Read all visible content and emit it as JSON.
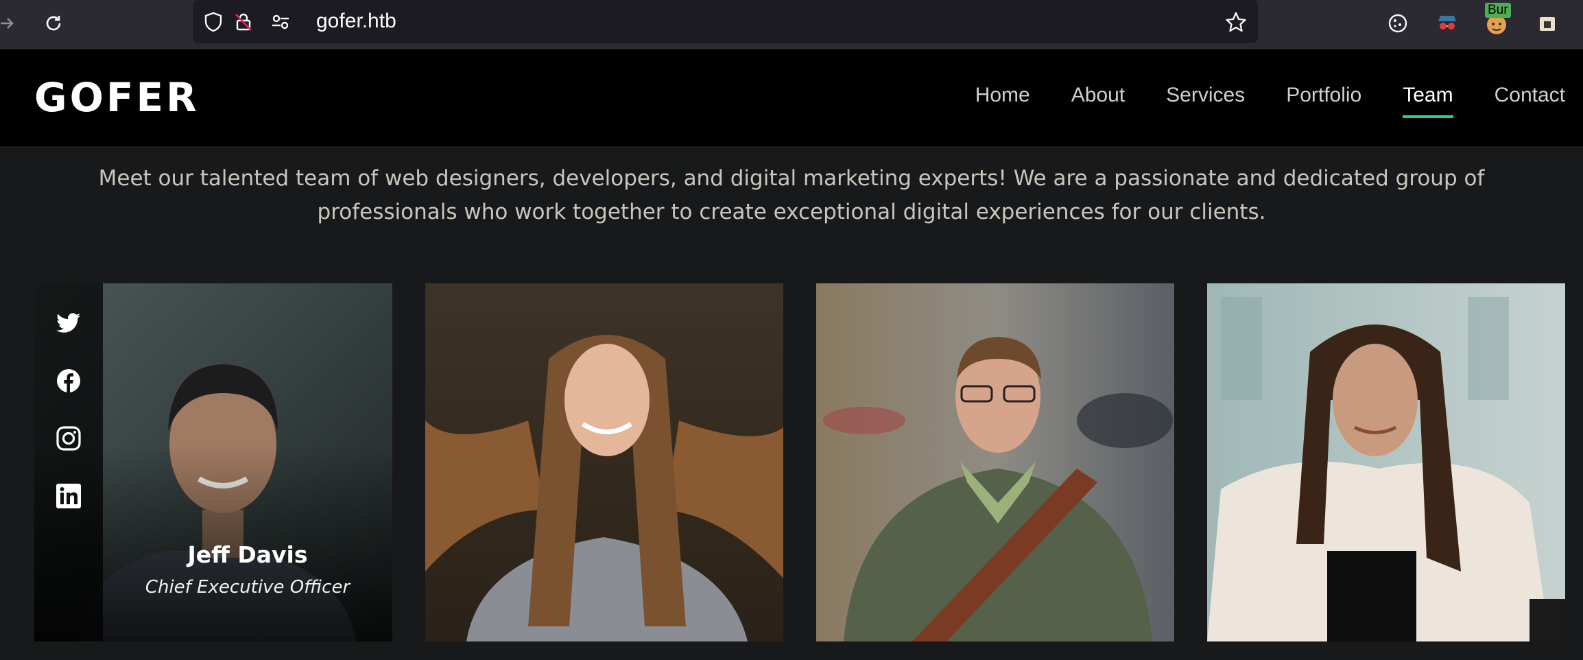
{
  "browser": {
    "url": "gofer.htb",
    "badge": "Bur"
  },
  "site": {
    "logo": "GOFER",
    "nav": [
      "Home",
      "About",
      "Services",
      "Portfolio",
      "Team",
      "Contact"
    ],
    "active_nav": "Team",
    "accent": "#18d2a6"
  },
  "team": {
    "intro": "Meet our talented team of web designers, developers, and digital marketing experts! We are a passionate and dedicated group of professionals who work together to create exceptional digital experiences for our clients.",
    "members": [
      {
        "name": "Jeff Davis",
        "role": "Chief Executive Officer",
        "social": [
          "twitter-icon",
          "facebook-icon",
          "instagram-icon",
          "linkedin-icon"
        ]
      },
      {
        "name": "",
        "role": ""
      },
      {
        "name": "",
        "role": ""
      },
      {
        "name": "",
        "role": ""
      }
    ]
  }
}
